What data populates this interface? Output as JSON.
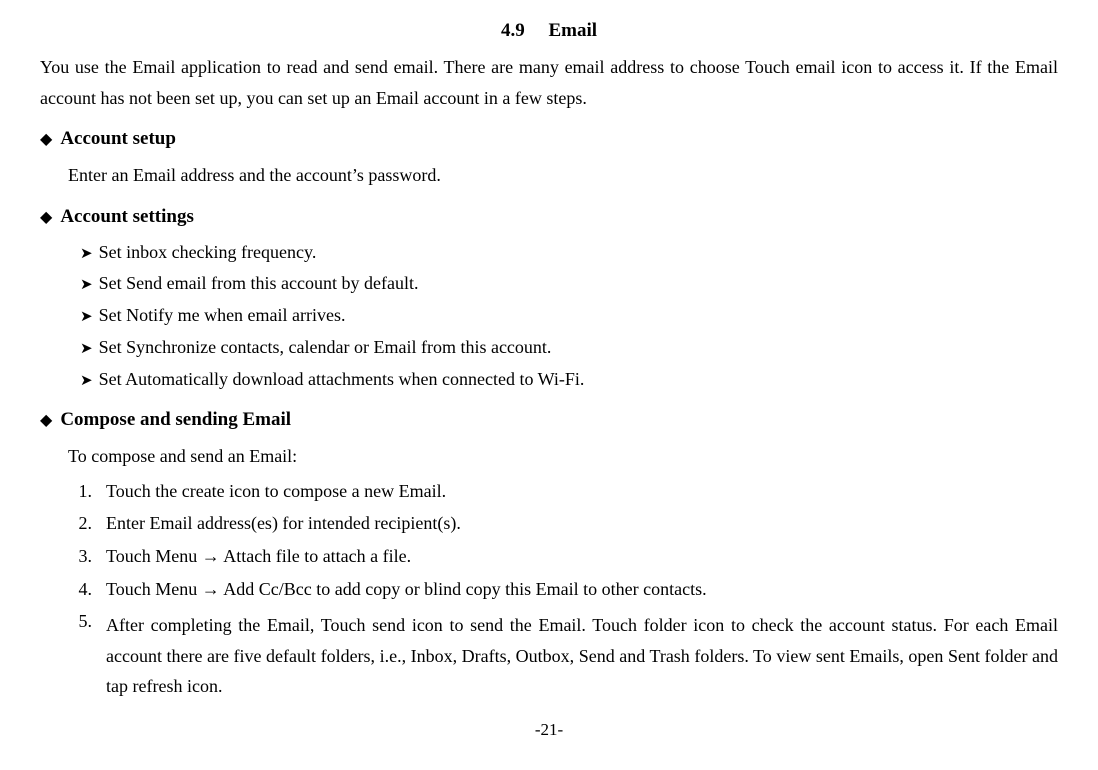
{
  "chapter": {
    "section_number": "4.9",
    "section_title": "Email"
  },
  "intro": {
    "paragraph": "You  use  the  Email  application  to  read  and  send  email.  There  are  many  email  address  to  choose Touch email icon to access it. If the Email account has not been set up, you can set up an Email account in a few steps."
  },
  "bullets": [
    {
      "id": "account-setup",
      "label": "Account setup",
      "body": "Enter an Email address and the account’s password.",
      "sub_items": []
    },
    {
      "id": "account-settings",
      "label": "Account settings",
      "body": "",
      "sub_items": [
        "Set inbox checking frequency.",
        "Set Send email from this account by default.",
        "Set Notify me when email arrives.",
        "Set Synchronize contacts, calendar or Email from this account.",
        "Set Automatically download attachments when connected to Wi-Fi."
      ]
    },
    {
      "id": "compose-sending",
      "label": "Compose and sending Email",
      "body": "To compose and send an Email:",
      "numbered_items": [
        "Touch the create icon to compose a new Email.",
        "Enter Email address(es) for intended recipient(s).",
        "Touch Menu  →  Attach file to attach a file.",
        "Touch Menu  →  Add Cc/Bcc to add copy or blind copy this Email to other contacts.",
        "After  completing  the  Email,  Touch  send  icon  to  send  the  Email.  Touch  folder  icon  to  check  the account status. For each Email account there are five default folders, i.e., Inbox, Drafts, Outbox, Send and Trash folders. To view sent Emails, open Sent folder and tap refresh icon."
      ]
    }
  ],
  "page_number": "-21-"
}
